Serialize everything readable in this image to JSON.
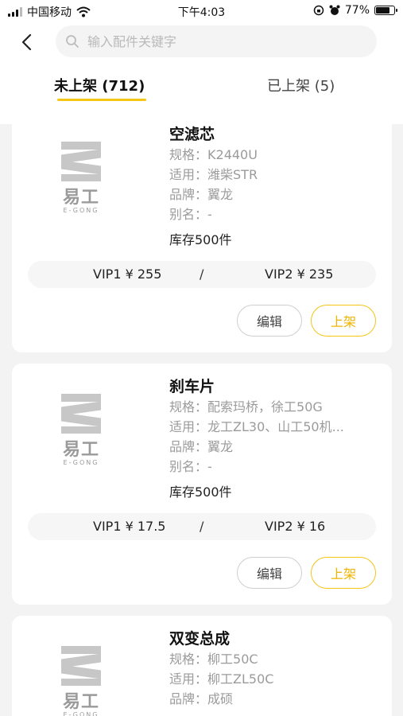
{
  "status_bar": {
    "carrier": "中国移动",
    "time": "下午4:03",
    "battery": "77%",
    "battery_level": 0.77,
    "icons": [
      "signal-icon",
      "wifi-icon",
      "lock-rotation-icon",
      "alarm-icon",
      "battery-icon"
    ]
  },
  "header": {
    "back_icon": "chevron-left-icon",
    "search_placeholder": "输入配件关键字",
    "search_value": ""
  },
  "tabs": [
    {
      "label": "未上架 (712)",
      "active": true
    },
    {
      "label": "已上架 (5)",
      "active": false
    }
  ],
  "brand_logo": {
    "mark": "易工",
    "sub": "E-GONG"
  },
  "labels": {
    "spec": "规格：",
    "apply": "适用：",
    "brand": "品牌：",
    "alias": "别名：",
    "edit": "编辑",
    "shelve": "上架",
    "separator": "/"
  },
  "products": [
    {
      "name": "空滤芯",
      "spec": "K2440U",
      "apply": "潍柴STR",
      "brand": "翼龙",
      "alias": "-",
      "stock": "库存500件",
      "vip1": "VIP1 ¥ 255",
      "vip2": "VIP2 ¥ 235"
    },
    {
      "name": "刹车片",
      "spec": "配索玛桥，徐工50G",
      "apply": "龙工ZL30、山工50机...",
      "brand": "翼龙",
      "alias": "-",
      "stock": "库存500件",
      "vip1": "VIP1 ¥ 17.5",
      "vip2": "VIP2 ¥ 16"
    },
    {
      "name": "双变总成",
      "spec": "柳工50C",
      "apply": "柳工ZL50C",
      "brand": "成硕"
    }
  ],
  "colors": {
    "accent": "#f5c518",
    "background": "#f3f3f3",
    "card": "#ffffff"
  }
}
